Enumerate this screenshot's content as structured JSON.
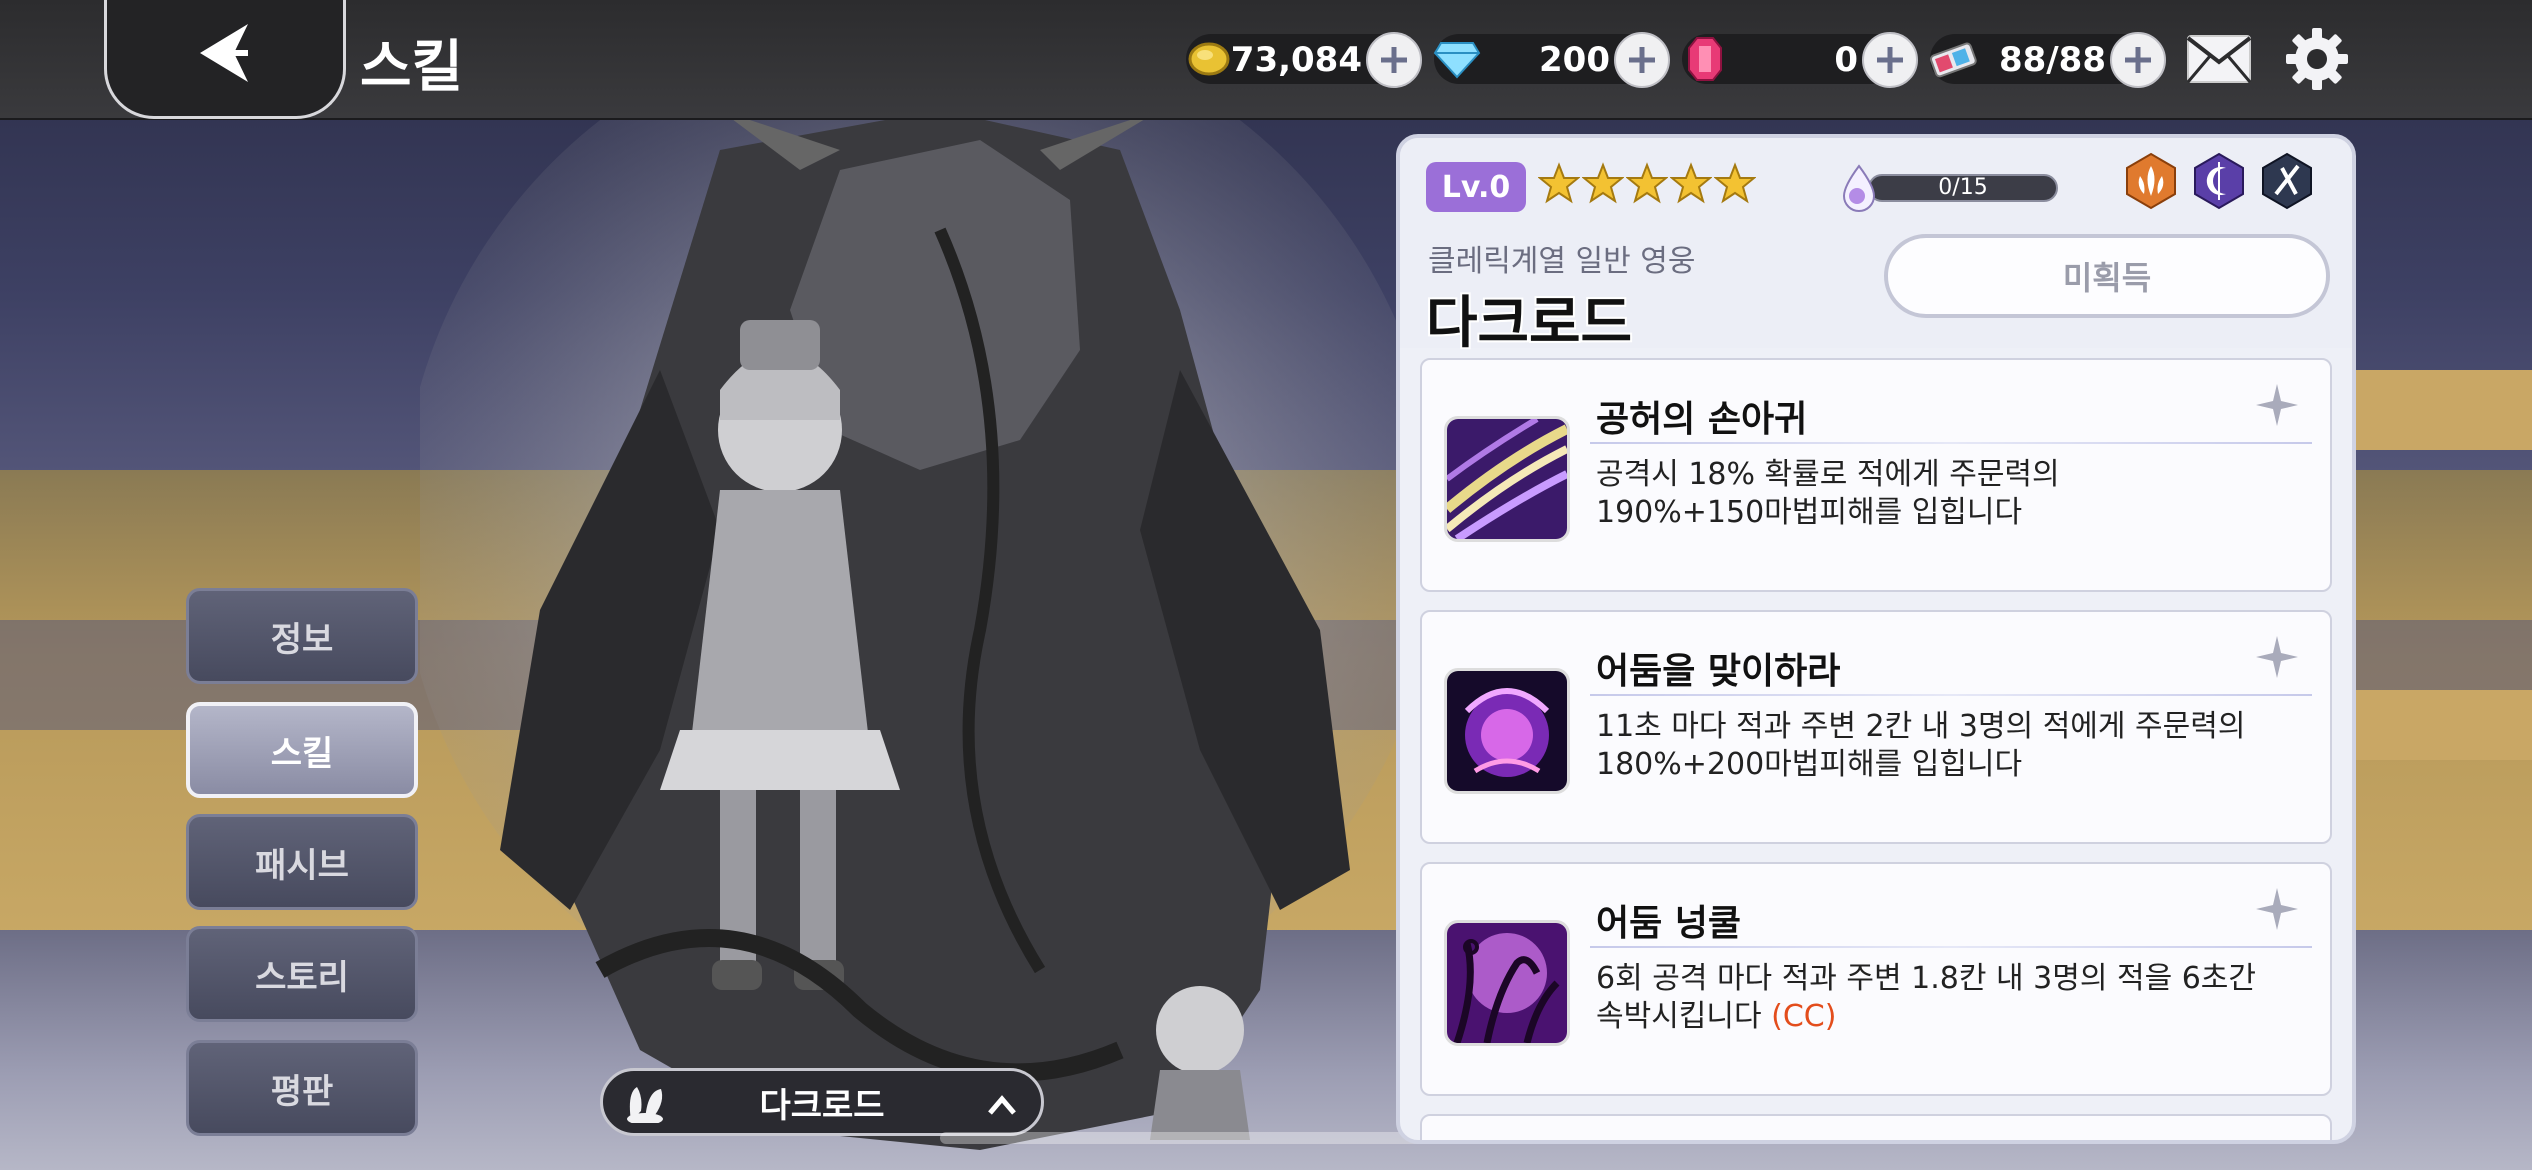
{
  "header": {
    "title": "스킬",
    "back_label": "back"
  },
  "currencies": [
    {
      "name": "gold",
      "value": "73,084"
    },
    {
      "name": "diamond",
      "value": "200"
    },
    {
      "name": "ruby",
      "value": "0"
    },
    {
      "name": "ticket",
      "value": "88/88"
    }
  ],
  "nav": {
    "items": [
      {
        "label": "정보",
        "active": false
      },
      {
        "label": "스킬",
        "active": true
      },
      {
        "label": "패시브",
        "active": false
      },
      {
        "label": "스토리",
        "active": false
      },
      {
        "label": "평판",
        "active": false
      }
    ]
  },
  "hero_selector": {
    "name": "다크로드"
  },
  "hero": {
    "level": "Lv.0",
    "stars": 5,
    "exp": "0/15",
    "exp_fraction": 0,
    "category": "클레릭계열 일반 영웅",
    "name": "다크로드",
    "status": "미획득",
    "class_icons": [
      "fire-emblem-icon",
      "moon-crest-icon",
      "crossed-swords-icon"
    ]
  },
  "skills": [
    {
      "name": "공허의 손아귀",
      "desc_line1": "공격시 18% 확률로 적에게 주문력의",
      "desc_line2": "190%+150마법피해를 입힙니다",
      "cc": ""
    },
    {
      "name": "어둠을 맞이하라",
      "desc_line1": "11초 마다 적과 주변 2칸 내 3명의 적에게 주문력의",
      "desc_line2": "180%+200마법피해를 입힙니다",
      "cc": ""
    },
    {
      "name": "어둠 넝쿨",
      "desc_line1": "6회 공격 마다 적과 주변 1.8칸 내 3명의 적을 6초간",
      "desc_line2": "속박시킵니다 ",
      "cc": "(CC)"
    }
  ],
  "colors": {
    "accent_purple": "#9b6fd8",
    "star_gold": "#f3c232",
    "cc_orange": "#e34d1c"
  }
}
